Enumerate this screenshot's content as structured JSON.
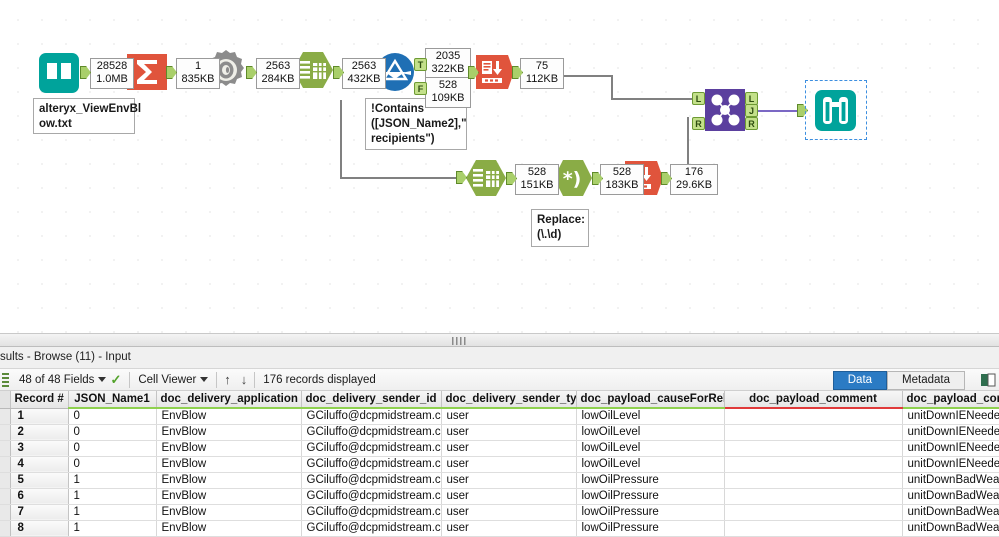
{
  "canvas": {
    "tools": [
      {
        "id": "input-data",
        "name": "input-data-tool",
        "icon": "book-icon"
      },
      {
        "id": "summarize",
        "name": "summarize-tool",
        "icon": "sigma-icon"
      },
      {
        "id": "json-parse",
        "name": "json-parse-tool",
        "icon": "gear-ring-icon"
      },
      {
        "id": "select-1",
        "name": "select-tool",
        "icon": "table-columns-icon"
      },
      {
        "id": "filter",
        "name": "filter-tool",
        "icon": "funnel-circle-icon"
      },
      {
        "id": "unique-1",
        "name": "unique-tool",
        "icon": "unique-rows-icon"
      },
      {
        "id": "select-2",
        "name": "select-tool",
        "icon": "table-columns-icon"
      },
      {
        "id": "regex",
        "name": "regex-tool",
        "icon": "regex-paren-icon"
      },
      {
        "id": "unique-2",
        "name": "unique-tool",
        "icon": "unique-rows-icon"
      },
      {
        "id": "join",
        "name": "join-tool",
        "icon": "join-nodes-icon"
      },
      {
        "id": "browse",
        "name": "browse-tool",
        "icon": "binoculars-icon"
      }
    ],
    "record_counts": [
      {
        "records": "28528",
        "size": "1.0MB"
      },
      {
        "records": "1",
        "size": "835KB"
      },
      {
        "records": "2563",
        "size": "284KB"
      },
      {
        "records": "2563",
        "size": "432KB"
      },
      {
        "records": "2035",
        "size": "322KB"
      },
      {
        "records": "528",
        "size": "109KB"
      },
      {
        "records": "75",
        "size": "112KB"
      },
      {
        "records": "528",
        "size": "151KB"
      },
      {
        "records": "528",
        "size": "183KB"
      },
      {
        "records": "176",
        "size": "29.6KB"
      }
    ],
    "annotations": [
      {
        "name": "input-file-annotation",
        "line1": "alteryx_ViewEnvBl",
        "line2": "ow.txt",
        "line3": ""
      },
      {
        "name": "filter-expression-annotation",
        "line1": "!Contains",
        "line2": "([JSON_Name2],\"",
        "line3": "recipients\")"
      },
      {
        "name": "regex-replace-annotation",
        "line1": "Replace:",
        "line2": "(\\.\\d)",
        "line3": ""
      }
    ],
    "ports": {
      "filter_true": "T",
      "filter_false": "F",
      "join_left": "L",
      "join_join": "J",
      "join_right": "R"
    }
  },
  "results": {
    "title": "sults - Browse (11) - Input",
    "toolbar": {
      "fields": "48 of 48 Fields",
      "viewer": "Cell Viewer",
      "sort_up": "↑",
      "sort_down": "↓",
      "records": "176 records displayed",
      "tab_data": "Data",
      "tab_metadata": "Metadata"
    },
    "columns": [
      {
        "label": "Record #",
        "underline": "none"
      },
      {
        "label": "JSON_Name1",
        "underline": "green"
      },
      {
        "label": "doc_delivery_application",
        "underline": "green"
      },
      {
        "label": "doc_delivery_sender_id",
        "underline": "green"
      },
      {
        "label": "doc_delivery_sender_type",
        "underline": "green"
      },
      {
        "label": "doc_payload_causeForRelease",
        "underline": "green"
      },
      {
        "label": "doc_payload_comment",
        "underline": "red"
      },
      {
        "label": "doc_payload_correctiveAct",
        "underline": "green"
      }
    ],
    "rows": [
      {
        "num": "1",
        "c": [
          "0",
          "EnvBlow",
          "GCiluffo@dcpmidstream.com",
          "user",
          "lowOilLevel",
          "",
          "unitDownIENeeded"
        ]
      },
      {
        "num": "2",
        "c": [
          "0",
          "EnvBlow",
          "GCiluffo@dcpmidstream.com",
          "user",
          "lowOilLevel",
          "",
          "unitDownIENeeded"
        ]
      },
      {
        "num": "3",
        "c": [
          "0",
          "EnvBlow",
          "GCiluffo@dcpmidstream.com",
          "user",
          "lowOilLevel",
          "",
          "unitDownIENeeded"
        ]
      },
      {
        "num": "4",
        "c": [
          "0",
          "EnvBlow",
          "GCiluffo@dcpmidstream.com",
          "user",
          "lowOilLevel",
          "",
          "unitDownIENeeded"
        ]
      },
      {
        "num": "5",
        "c": [
          "1",
          "EnvBlow",
          "GCiluffo@dcpmidstream.com",
          "user",
          "lowOilPressure",
          "",
          "unitDownBadWeather"
        ]
      },
      {
        "num": "6",
        "c": [
          "1",
          "EnvBlow",
          "GCiluffo@dcpmidstream.com",
          "user",
          "lowOilPressure",
          "",
          "unitDownBadWeather"
        ]
      },
      {
        "num": "7",
        "c": [
          "1",
          "EnvBlow",
          "GCiluffo@dcpmidstream.com",
          "user",
          "lowOilPressure",
          "",
          "unitDownBadWeather"
        ]
      },
      {
        "num": "8",
        "c": [
          "1",
          "EnvBlow",
          "GCiluffo@dcpmidstream.com",
          "user",
          "lowOilPressure",
          "",
          "unitDownBadWeather"
        ]
      }
    ]
  },
  "colors": {
    "teal": "#00a39b",
    "orange": "#e0543c",
    "green": "#8aac46",
    "blue": "#1f6fb4",
    "purple": "#5b3f9e",
    "grey": "#8c8c8c",
    "accent_blue": "#2b7bc4",
    "underline_green": "#8fd14f",
    "underline_red": "#e03a3a"
  }
}
